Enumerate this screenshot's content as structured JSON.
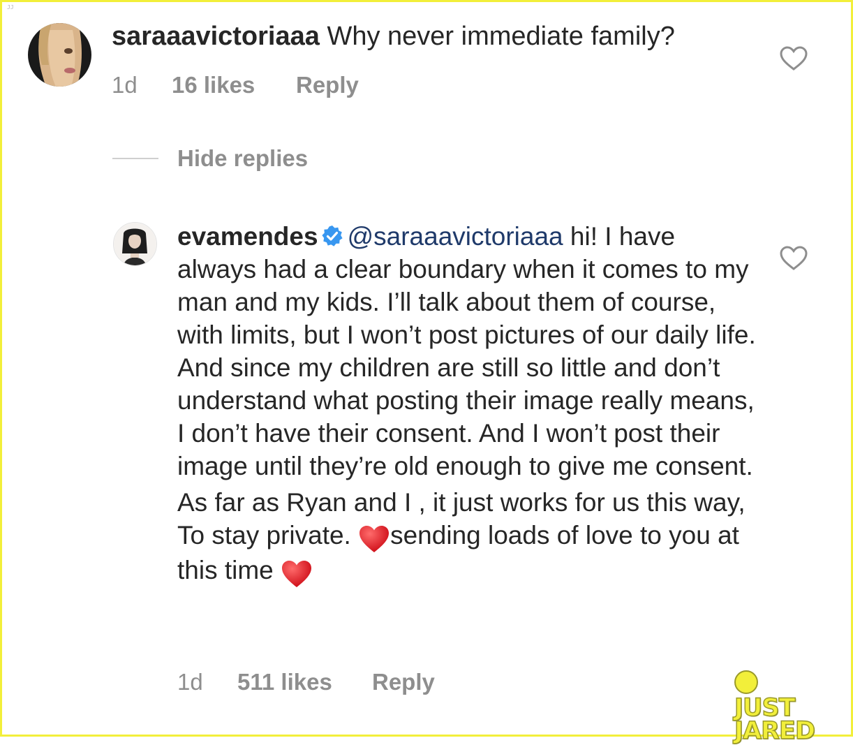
{
  "corner_mark": "JJ",
  "comment": {
    "username": "saraaavictoriaaa",
    "text": "Why never immediate family?",
    "time": "1d",
    "likes": "16 likes",
    "reply_label": "Reply"
  },
  "replies_toggle": {
    "label": "Hide replies"
  },
  "reply": {
    "username": "evamendes",
    "mention": "@saraaavictoriaaa",
    "text_part1": " hi! I have always had a clear boundary when it comes to my man and my kids. I’ll talk about them of course, with limits, but I won’t post pictures of our daily life. And since my children are still so little and don’t understand what posting their image really means, I don’t have their consent. And I won’t post their image until they’re old enough to give me consent.",
    "text_part2a": "As far as Ryan and I , it just works for us this way, To stay private. ",
    "text_part2b": "sending loads of love to you at this time ",
    "time": "1d",
    "likes": "511 likes",
    "reply_label": "Reply"
  },
  "watermark": {
    "line1": "JUST",
    "line2": "JARED"
  },
  "colors": {
    "frame_border": "#f2ef3a",
    "meta_text": "#8e8e8e",
    "mention": "#1f3a6a",
    "verified_badge": "#3897f0",
    "heart_emoji": "#e0242c"
  },
  "icons": [
    "heart-outline-icon",
    "verified-badge-icon",
    "red-heart-emoji-icon"
  ]
}
